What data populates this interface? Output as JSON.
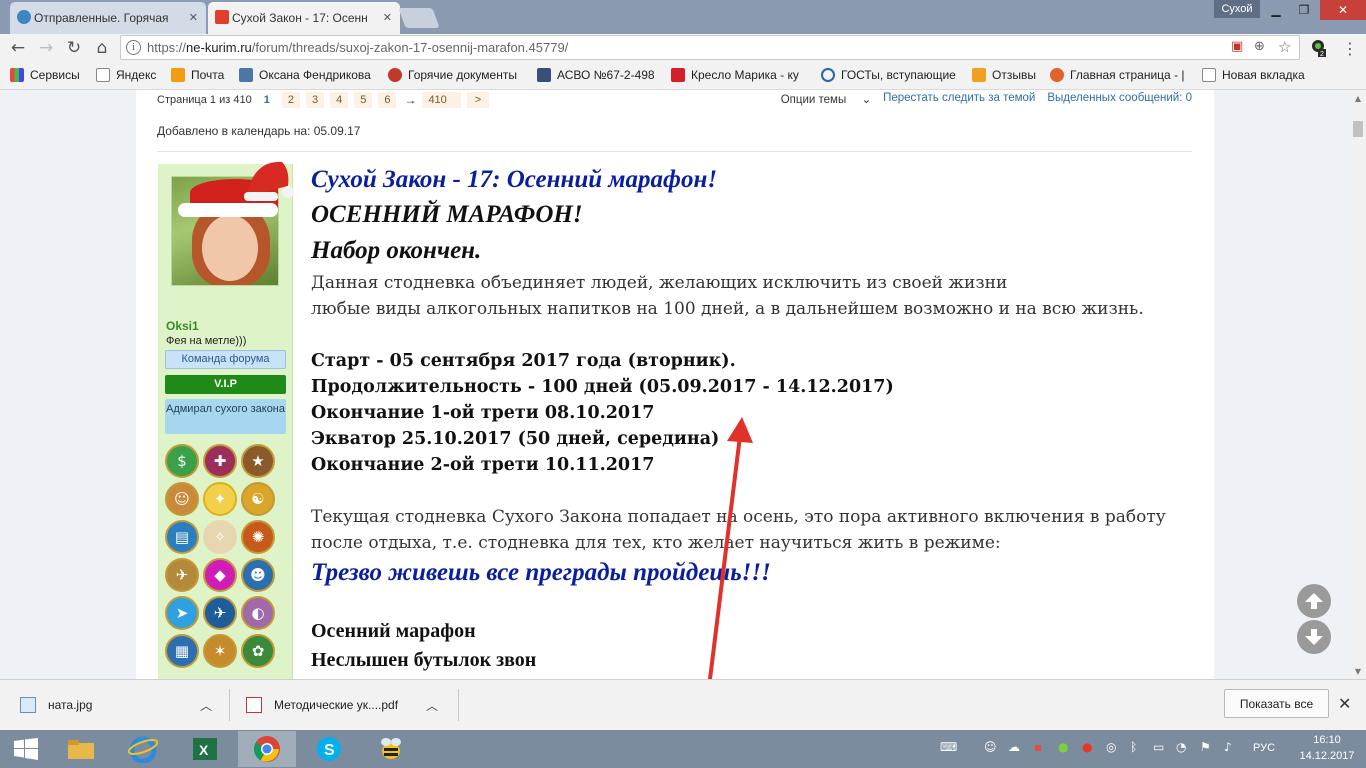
{
  "browser": {
    "tabs": [
      {
        "title": "Отправленные. Горячая"
      },
      {
        "title": "Сухой Закон - 17: Осенн"
      }
    ],
    "profile_name": "Сухой",
    "url_host": "ne-kurim.ru",
    "url_path": "/forum/threads/suxoj-zakon-17-osennij-marafon.45779/",
    "url_scheme": "https://",
    "extension_badge": "2",
    "bookmarks": [
      {
        "label": "Сервисы"
      },
      {
        "label": "Яндекс"
      },
      {
        "label": "Почта"
      },
      {
        "label": "Оксана Фендрикова"
      },
      {
        "label": "Горячие документы"
      },
      {
        "label": "АСВО №67-2-498"
      },
      {
        "label": "Кресло Марика - ку"
      },
      {
        "label": "ГОСТы, вступающие"
      },
      {
        "label": "Отзывы"
      },
      {
        "label": "Главная страница - |"
      },
      {
        "label": "Новая вкладка"
      }
    ]
  },
  "thread": {
    "pager_label": "Страница 1 из 410",
    "pages": [
      "1",
      "2",
      "3",
      "4",
      "5",
      "6"
    ],
    "arrow": "→",
    "last_page": "410",
    "next": ">",
    "options": "Опции темы",
    "unwatch": "Перестать следить за темой",
    "selected": "Выделенных сообщений: 0",
    "calendar": "Добавлено в календарь на: 05.09.17"
  },
  "user": {
    "name": "Oksi1",
    "title": "Фея на метле)))",
    "badge_team": "Команда форума",
    "badge_vip": "V.I.P",
    "badge_admiral": "Адмирал сухого закона"
  },
  "post": {
    "title": "Сухой Закон - 17: Осенний марафон!",
    "heading1": "ОСЕННИЙ МАРАФОН!",
    "heading2": "Набор окончен.",
    "intro1": "Данная стодневка объединяет людей, желающих исключить из своей жизни",
    "intro2": "любые виды алкогольных напитков на 100 дней, а в дальнейшем возможно и на всю жизнь.",
    "start": "Старт - 05 сентября 2017 года (вторник).",
    "duration": "Продолжительность - 100 дней (05.09.2017 - 14.12.2017)",
    "third1": "Окончание 1-ой трети 08.10.2017",
    "equator": "Экватор 25.10.2017 (50 дней, середина)",
    "third2": "Окончание 2-ой трети 10.11.2017",
    "para1": "Текущая стодневка Сухого Закона попадает на осень, это пора активного включения в работу",
    "para2": "после отдыха, т.е. стодневка для тех, кто желает научиться жить в режиме:",
    "motto": "Трезво живешь все преграды пройдешь!!!",
    "verse1": "Осенний марафон",
    "verse2": "Неслышен бутылок звон"
  },
  "downloads": {
    "file1": "ната.jpg",
    "file2": "Методические ук....pdf",
    "show_all": "Показать все"
  },
  "taskbar": {
    "lang": "РУС",
    "time": "16:10",
    "date": "14.12.2017"
  },
  "colors": {
    "accent_blue": "#0a1fa0",
    "arrow_red": "#e0322b",
    "panel_green": "#dff3c9"
  }
}
